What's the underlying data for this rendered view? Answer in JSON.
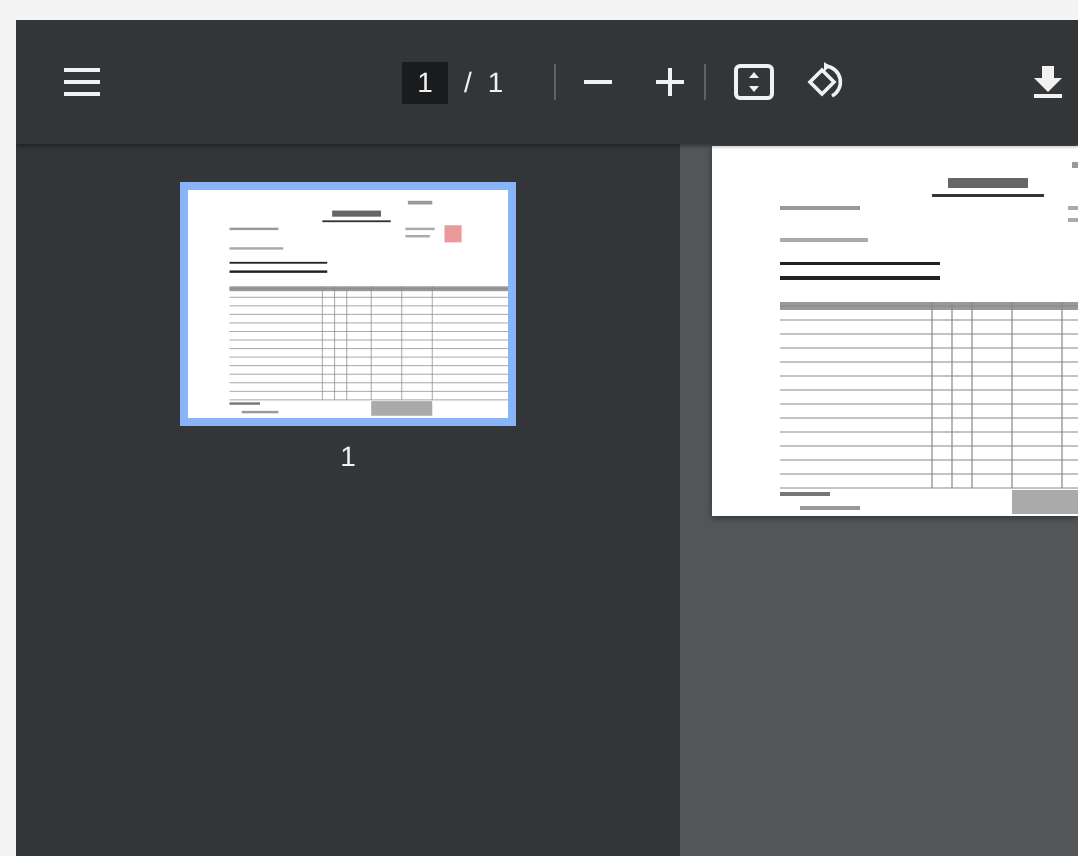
{
  "toolbar": {
    "page_input": {
      "value": "1"
    },
    "page_separator": "/",
    "page_count": "1"
  },
  "thumbnails": [
    {
      "label": "1",
      "selected": true
    }
  ]
}
